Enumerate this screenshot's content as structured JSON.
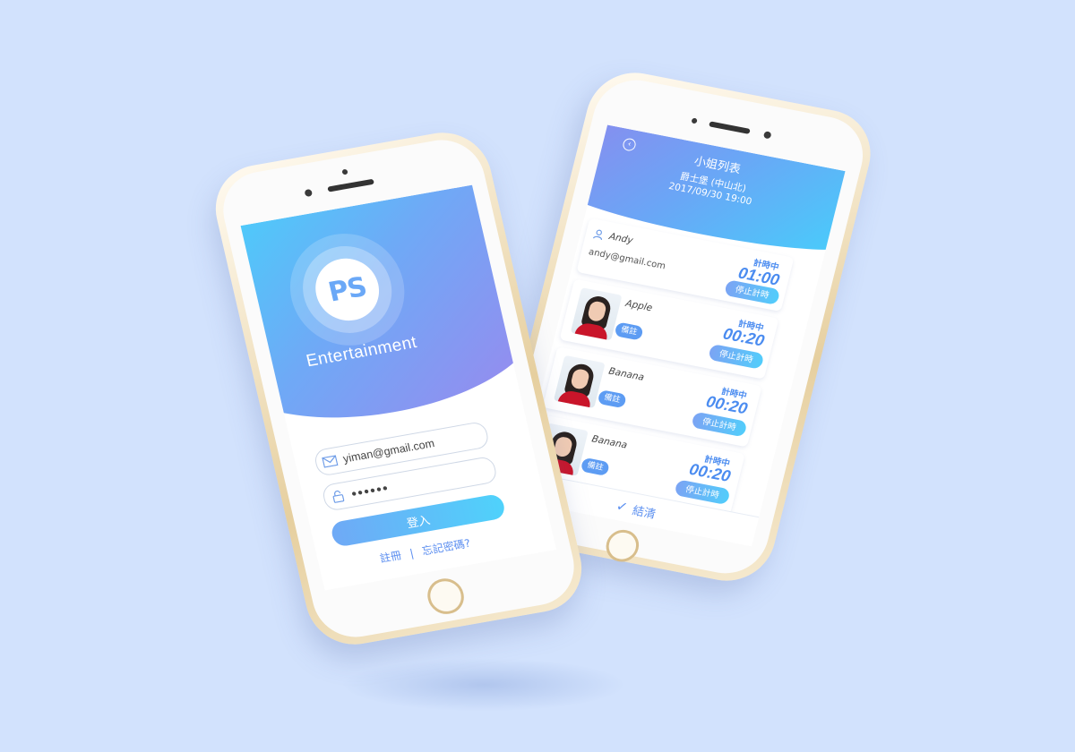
{
  "login": {
    "logo_text": "PS",
    "brand": "Entertainment",
    "email_value": "yiman@gmail.com",
    "password_value": "●●●●●●",
    "login_button": "登入",
    "register_link": "註冊",
    "separator": "|",
    "forgot_link": "忘記密碼?"
  },
  "list": {
    "back_symbol": "‹",
    "title": "小姐列表",
    "subtitle_place": "爵士堡 (中山北)",
    "subtitle_datetime": "2017/09/30 19:00",
    "customer": {
      "name": "Andy",
      "email": "andy@gmail.com",
      "timer_label": "計時中",
      "timer_value": "01:00",
      "stop_label": "停止計時"
    },
    "items": [
      {
        "name": "Apple",
        "tag": "備註",
        "timer_label": "計時中",
        "timer_value": "00:20",
        "stop_label": "停止計時"
      },
      {
        "name": "Banana",
        "tag": "備註",
        "timer_label": "計時中",
        "timer_value": "00:20",
        "stop_label": "停止計時"
      },
      {
        "name": "Banana",
        "tag": "備註",
        "timer_label": "計時中",
        "timer_value": "00:20",
        "stop_label": "停止計時"
      }
    ],
    "checkout_label": "結清",
    "checkout_icon": "✓",
    "fab_icon": "+"
  },
  "colors": {
    "background": "#d2e2fd",
    "accent_blue": "#4b8cf0",
    "gradient_cyan": "#45d0fb",
    "gradient_purple": "#9a88ee",
    "gold_frame": "#e6cf9f"
  }
}
